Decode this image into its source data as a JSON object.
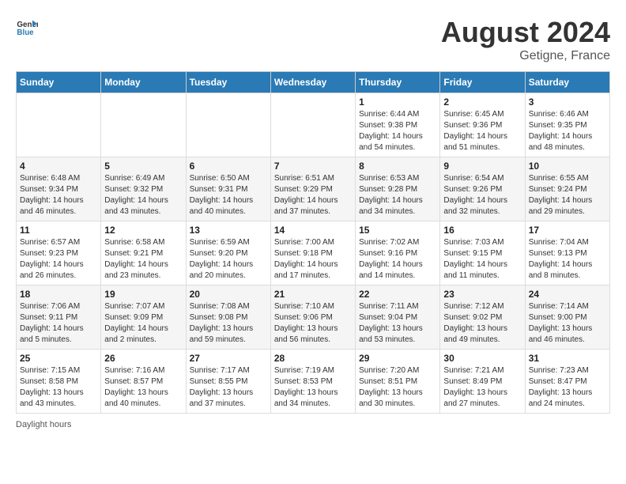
{
  "header": {
    "logo_general": "General",
    "logo_blue": "Blue",
    "month_year": "August 2024",
    "location": "Getigne, France"
  },
  "weekdays": [
    "Sunday",
    "Monday",
    "Tuesday",
    "Wednesday",
    "Thursday",
    "Friday",
    "Saturday"
  ],
  "weeks": [
    [
      {
        "day": "",
        "info": ""
      },
      {
        "day": "",
        "info": ""
      },
      {
        "day": "",
        "info": ""
      },
      {
        "day": "",
        "info": ""
      },
      {
        "day": "1",
        "info": "Sunrise: 6:44 AM\nSunset: 9:38 PM\nDaylight: 14 hours\nand 54 minutes."
      },
      {
        "day": "2",
        "info": "Sunrise: 6:45 AM\nSunset: 9:36 PM\nDaylight: 14 hours\nand 51 minutes."
      },
      {
        "day": "3",
        "info": "Sunrise: 6:46 AM\nSunset: 9:35 PM\nDaylight: 14 hours\nand 48 minutes."
      }
    ],
    [
      {
        "day": "4",
        "info": "Sunrise: 6:48 AM\nSunset: 9:34 PM\nDaylight: 14 hours\nand 46 minutes."
      },
      {
        "day": "5",
        "info": "Sunrise: 6:49 AM\nSunset: 9:32 PM\nDaylight: 14 hours\nand 43 minutes."
      },
      {
        "day": "6",
        "info": "Sunrise: 6:50 AM\nSunset: 9:31 PM\nDaylight: 14 hours\nand 40 minutes."
      },
      {
        "day": "7",
        "info": "Sunrise: 6:51 AM\nSunset: 9:29 PM\nDaylight: 14 hours\nand 37 minutes."
      },
      {
        "day": "8",
        "info": "Sunrise: 6:53 AM\nSunset: 9:28 PM\nDaylight: 14 hours\nand 34 minutes."
      },
      {
        "day": "9",
        "info": "Sunrise: 6:54 AM\nSunset: 9:26 PM\nDaylight: 14 hours\nand 32 minutes."
      },
      {
        "day": "10",
        "info": "Sunrise: 6:55 AM\nSunset: 9:24 PM\nDaylight: 14 hours\nand 29 minutes."
      }
    ],
    [
      {
        "day": "11",
        "info": "Sunrise: 6:57 AM\nSunset: 9:23 PM\nDaylight: 14 hours\nand 26 minutes."
      },
      {
        "day": "12",
        "info": "Sunrise: 6:58 AM\nSunset: 9:21 PM\nDaylight: 14 hours\nand 23 minutes."
      },
      {
        "day": "13",
        "info": "Sunrise: 6:59 AM\nSunset: 9:20 PM\nDaylight: 14 hours\nand 20 minutes."
      },
      {
        "day": "14",
        "info": "Sunrise: 7:00 AM\nSunset: 9:18 PM\nDaylight: 14 hours\nand 17 minutes."
      },
      {
        "day": "15",
        "info": "Sunrise: 7:02 AM\nSunset: 9:16 PM\nDaylight: 14 hours\nand 14 minutes."
      },
      {
        "day": "16",
        "info": "Sunrise: 7:03 AM\nSunset: 9:15 PM\nDaylight: 14 hours\nand 11 minutes."
      },
      {
        "day": "17",
        "info": "Sunrise: 7:04 AM\nSunset: 9:13 PM\nDaylight: 14 hours\nand 8 minutes."
      }
    ],
    [
      {
        "day": "18",
        "info": "Sunrise: 7:06 AM\nSunset: 9:11 PM\nDaylight: 14 hours\nand 5 minutes."
      },
      {
        "day": "19",
        "info": "Sunrise: 7:07 AM\nSunset: 9:09 PM\nDaylight: 14 hours\nand 2 minutes."
      },
      {
        "day": "20",
        "info": "Sunrise: 7:08 AM\nSunset: 9:08 PM\nDaylight: 13 hours\nand 59 minutes."
      },
      {
        "day": "21",
        "info": "Sunrise: 7:10 AM\nSunset: 9:06 PM\nDaylight: 13 hours\nand 56 minutes."
      },
      {
        "day": "22",
        "info": "Sunrise: 7:11 AM\nSunset: 9:04 PM\nDaylight: 13 hours\nand 53 minutes."
      },
      {
        "day": "23",
        "info": "Sunrise: 7:12 AM\nSunset: 9:02 PM\nDaylight: 13 hours\nand 49 minutes."
      },
      {
        "day": "24",
        "info": "Sunrise: 7:14 AM\nSunset: 9:00 PM\nDaylight: 13 hours\nand 46 minutes."
      }
    ],
    [
      {
        "day": "25",
        "info": "Sunrise: 7:15 AM\nSunset: 8:58 PM\nDaylight: 13 hours\nand 43 minutes."
      },
      {
        "day": "26",
        "info": "Sunrise: 7:16 AM\nSunset: 8:57 PM\nDaylight: 13 hours\nand 40 minutes."
      },
      {
        "day": "27",
        "info": "Sunrise: 7:17 AM\nSunset: 8:55 PM\nDaylight: 13 hours\nand 37 minutes."
      },
      {
        "day": "28",
        "info": "Sunrise: 7:19 AM\nSunset: 8:53 PM\nDaylight: 13 hours\nand 34 minutes."
      },
      {
        "day": "29",
        "info": "Sunrise: 7:20 AM\nSunset: 8:51 PM\nDaylight: 13 hours\nand 30 minutes."
      },
      {
        "day": "30",
        "info": "Sunrise: 7:21 AM\nSunset: 8:49 PM\nDaylight: 13 hours\nand 27 minutes."
      },
      {
        "day": "31",
        "info": "Sunrise: 7:23 AM\nSunset: 8:47 PM\nDaylight: 13 hours\nand 24 minutes."
      }
    ]
  ],
  "footer": {
    "daylight_label": "Daylight hours"
  }
}
